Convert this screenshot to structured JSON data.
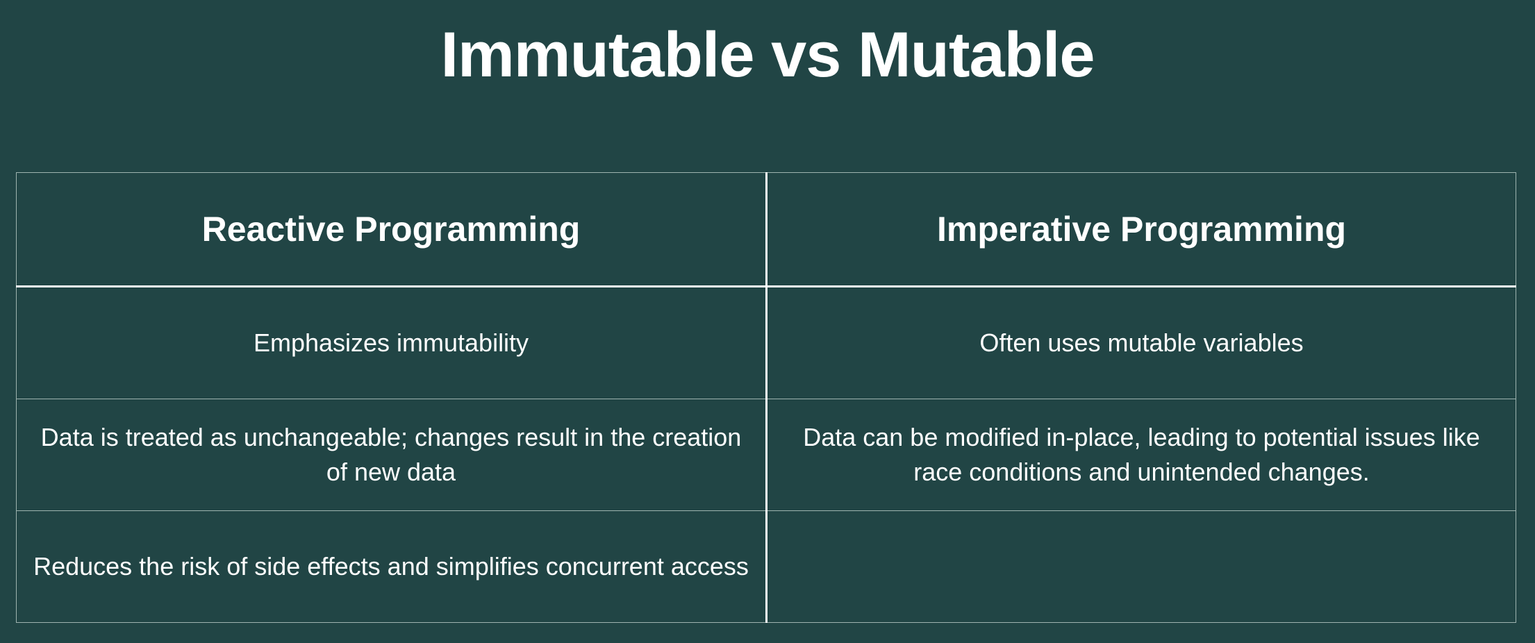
{
  "title": "Immutable vs Mutable",
  "table": {
    "headers": [
      "Reactive Programming",
      "Imperative Programming"
    ],
    "rows": [
      [
        "Emphasizes immutability",
        "Often uses mutable variables"
      ],
      [
        "Data is treated as unchangeable; changes result in the creation of new data",
        "Data can be modified in-place, leading to potential issues like race conditions and unintended changes."
      ],
      [
        "Reduces the risk of side effects and simplifies concurrent access",
        ""
      ]
    ]
  },
  "colors": {
    "background": "#214545",
    "text": "#ffffff",
    "grid_line": "#9fb4b0"
  }
}
